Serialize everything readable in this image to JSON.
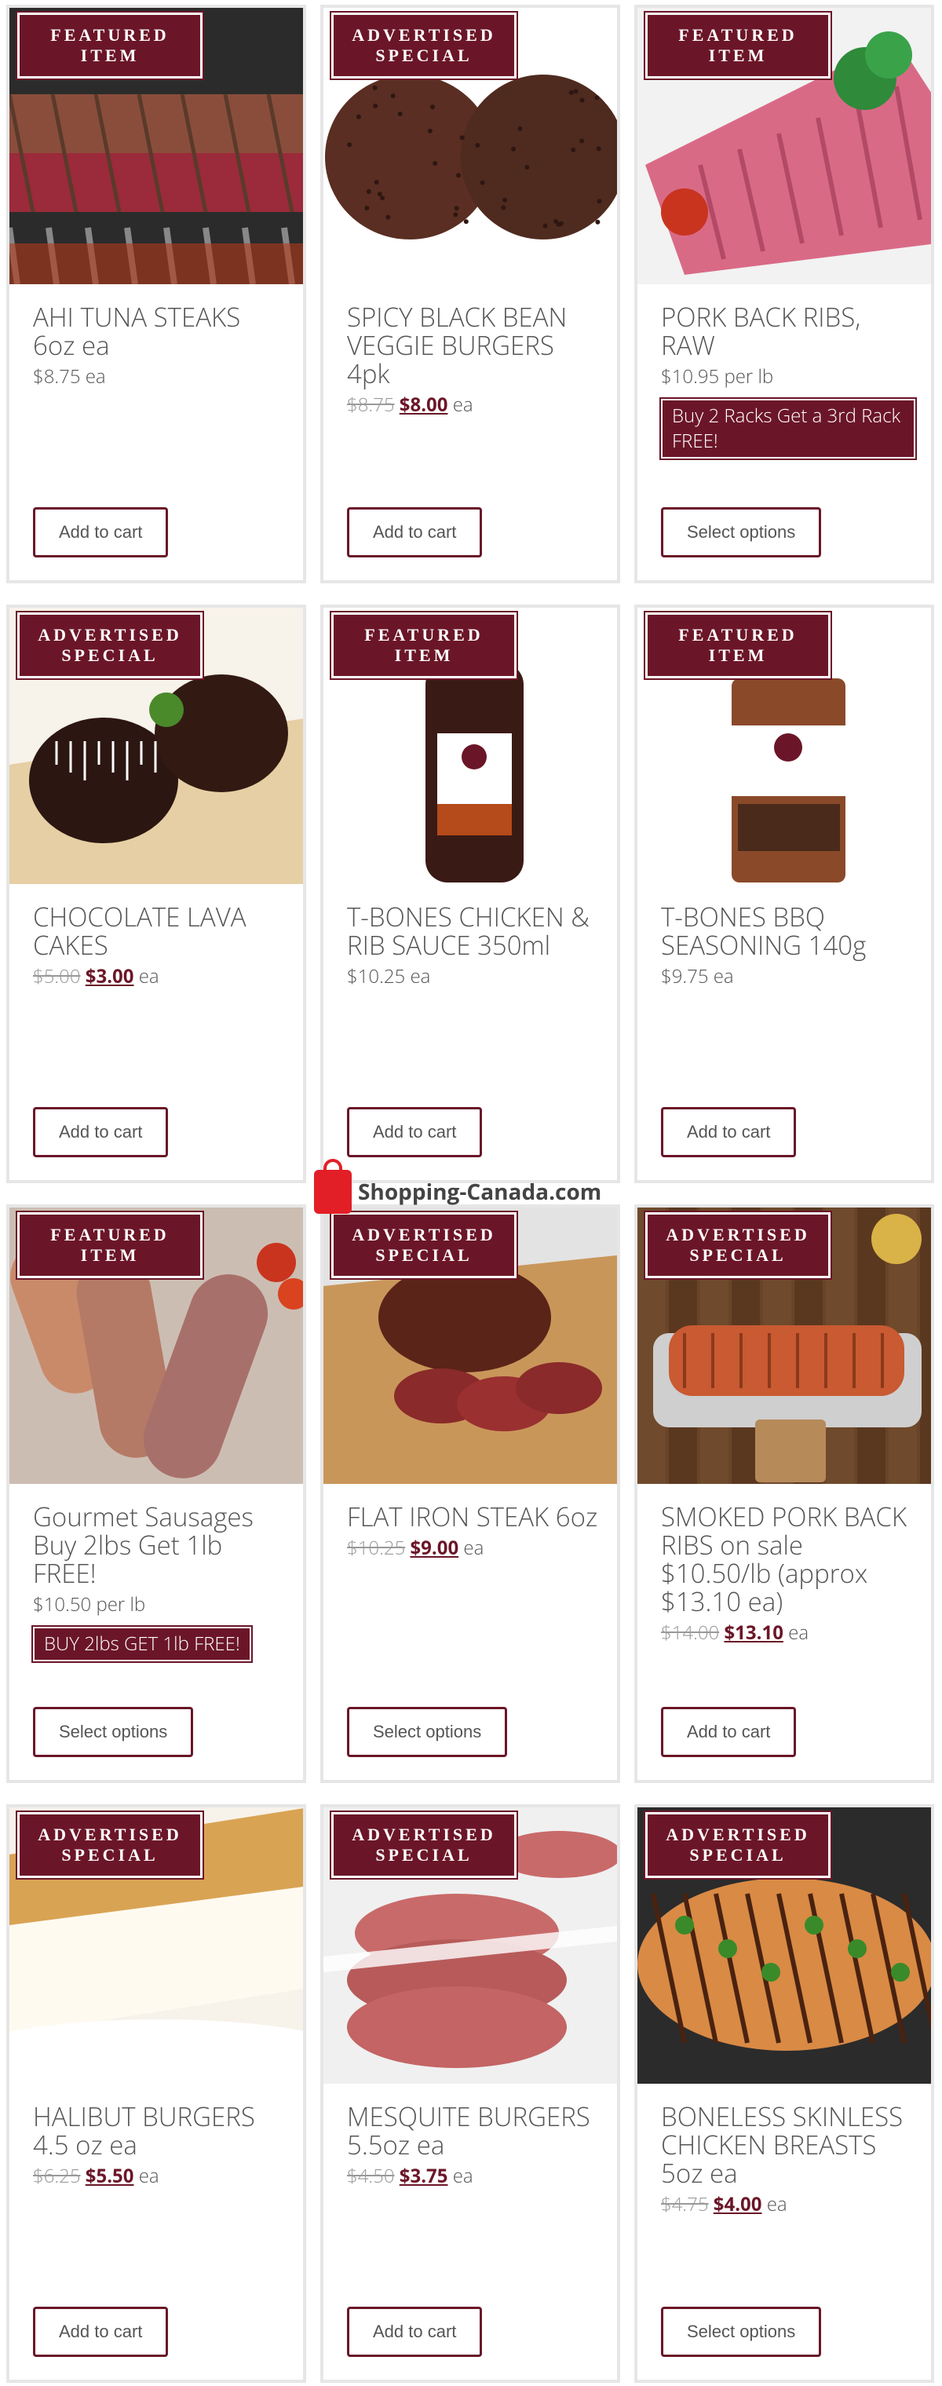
{
  "products": [
    {
      "badge": [
        "FEATURED",
        "ITEM"
      ],
      "title": "AHI TUNA STEAKS 6oz ea",
      "price": "$8.75 ea",
      "old_price": "",
      "new_price": "",
      "unit": "",
      "promo": "",
      "button": "Add to cart",
      "image_theme": "tuna"
    },
    {
      "badge": [
        "ADVERTISED",
        "SPECIAL"
      ],
      "title": "SPICY BLACK BEAN VEGGIE BURGERS 4pk",
      "price": "",
      "old_price": "$8.75",
      "new_price": "$8.00",
      "unit": "ea",
      "promo": "",
      "button": "Add to cart",
      "image_theme": "beanburgers"
    },
    {
      "badge": [
        "FEATURED",
        "ITEM"
      ],
      "title": "PORK BACK RIBS, RAW",
      "price": "$10.95 per lb",
      "old_price": "",
      "new_price": "",
      "unit": "",
      "promo": "Buy 2 Racks Get a 3rd Rack FREE!",
      "button": "Select options",
      "image_theme": "rawribs"
    },
    {
      "badge": [
        "ADVERTISED",
        "SPECIAL"
      ],
      "title": "CHOCOLATE LAVA CAKES",
      "price": "",
      "old_price": "$5.00",
      "new_price": "$3.00",
      "unit": "ea",
      "promo": "",
      "button": "Add to cart",
      "image_theme": "lavacake"
    },
    {
      "badge": [
        "FEATURED",
        "ITEM"
      ],
      "title": "T-BONES CHICKEN & RIB SAUCE 350ml",
      "price": "$10.25 ea",
      "old_price": "",
      "new_price": "",
      "unit": "",
      "promo": "",
      "button": "Add to cart",
      "image_theme": "sauce"
    },
    {
      "badge": [
        "FEATURED",
        "ITEM"
      ],
      "title": "T-BONES BBQ SEASONING 140g",
      "price": "$9.75 ea",
      "old_price": "",
      "new_price": "",
      "unit": "",
      "promo": "",
      "button": "Add to cart",
      "image_theme": "seasoning"
    },
    {
      "badge": [
        "FEATURED",
        "ITEM"
      ],
      "title": "Gourmet Sausages Buy 2lbs Get 1lb FREE!",
      "price": "$10.50 per lb",
      "old_price": "",
      "new_price": "",
      "unit": "",
      "promo": "BUY 2lbs GET 1lb FREE!",
      "button": "Select options",
      "image_theme": "sausages"
    },
    {
      "badge": [
        "ADVERTISED",
        "SPECIAL"
      ],
      "title": "FLAT IRON STEAK 6oz",
      "price": "",
      "old_price": "$10.25",
      "new_price": "$9.00",
      "unit": "ea",
      "promo": "",
      "button": "Select options",
      "image_theme": "steak"
    },
    {
      "badge": [
        "ADVERTISED",
        "SPECIAL"
      ],
      "title": "SMOKED PORK BACK RIBS on sale $10.50/lb (approx $13.10 ea)",
      "price": "",
      "old_price": "$14.00",
      "new_price": "$13.10",
      "unit": "ea",
      "promo": "",
      "button": "Add to cart",
      "image_theme": "smokedribs"
    },
    {
      "badge": [
        "ADVERTISED",
        "SPECIAL"
      ],
      "title": "HALIBUT BURGERS 4.5 oz ea",
      "price": "",
      "old_price": "$6.25",
      "new_price": "$5.50",
      "unit": "ea",
      "promo": "",
      "button": "Add to cart",
      "image_theme": "halibut"
    },
    {
      "badge": [
        "ADVERTISED",
        "SPECIAL"
      ],
      "title": "MESQUITE BURGERS 5.5oz ea",
      "price": "",
      "old_price": "$4.50",
      "new_price": "$3.75",
      "unit": "ea",
      "promo": "",
      "button": "Add to cart",
      "image_theme": "mesquite"
    },
    {
      "badge": [
        "ADVERTISED",
        "SPECIAL"
      ],
      "title": "BONELESS SKINLESS CHICKEN BREASTS 5oz ea",
      "price": "",
      "old_price": "$4.75",
      "new_price": "$4.00",
      "unit": "ea",
      "promo": "",
      "button": "Select options",
      "image_theme": "chicken"
    }
  ],
  "watermark": {
    "text": "Shopping-Canada.com"
  },
  "colors": {
    "brand": "#6b1628",
    "text": "#555555",
    "strike": "#999999"
  }
}
